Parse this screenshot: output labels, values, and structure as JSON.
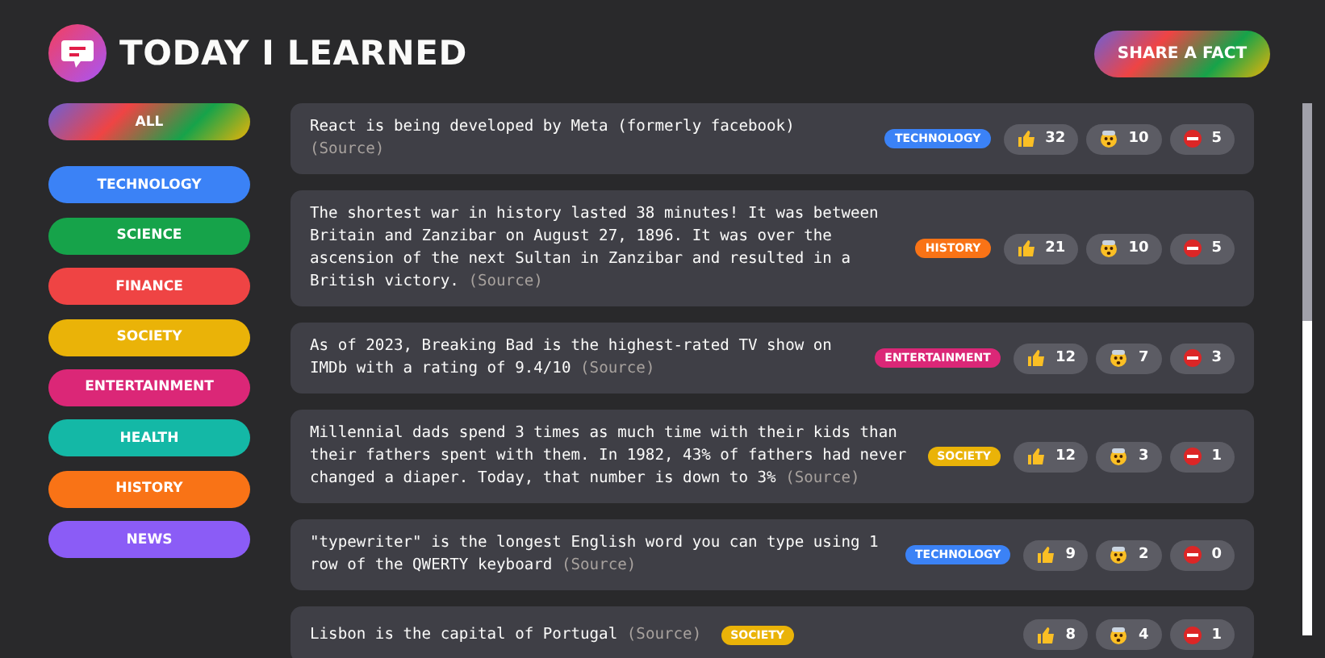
{
  "header": {
    "title": "TODAY I LEARNED",
    "share_button": "SHARE A FACT"
  },
  "categories": [
    {
      "label": "ALL",
      "kind": "all"
    },
    {
      "label": "TECHNOLOGY",
      "kind": "category",
      "color": "#3b82f6"
    },
    {
      "label": "SCIENCE",
      "kind": "category",
      "color": "#16a34a"
    },
    {
      "label": "FINANCE",
      "kind": "category",
      "color": "#ef4444"
    },
    {
      "label": "SOCIETY",
      "kind": "category",
      "color": "#eab308"
    },
    {
      "label": "ENTERTAINMENT",
      "kind": "category",
      "color": "#db2777"
    },
    {
      "label": "HEALTH",
      "kind": "category",
      "color": "#14b8a6"
    },
    {
      "label": "HISTORY",
      "kind": "category",
      "color": "#f97316"
    },
    {
      "label": "NEWS",
      "kind": "category",
      "color": "#8b5cf6"
    }
  ],
  "facts": [
    {
      "text": "React is being developed by Meta (formerly facebook)",
      "source": "(Source)",
      "tag": "TECHNOLOGY",
      "color": "#3b82f6",
      "votes": [
        "32",
        "10",
        "5"
      ]
    },
    {
      "text": "The shortest war in history lasted 38 minutes! It was between Britain and Zanzibar on August 27, 1896. It was over the ascension of the next Sultan in Zanzibar and resulted in a British victory.",
      "source": "(Source)",
      "tag": "HISTORY",
      "color": "#f97316",
      "votes": [
        "21",
        "10",
        "5"
      ]
    },
    {
      "text": "As of 2023, Breaking Bad is the highest-rated TV show on IMDb with a rating of 9.4/10",
      "source": "(Source)",
      "tag": "ENTERTAINMENT",
      "color": "#db2777",
      "votes": [
        "12",
        "7",
        "3"
      ]
    },
    {
      "text": "Millennial dads spend 3 times as much time with their kids than their fathers spent with them. In 1982, 43% of fathers had never changed a diaper. Today, that number is down to 3%",
      "source": "(Source)",
      "tag": "SOCIETY",
      "color": "#eab308",
      "votes": [
        "12",
        "3",
        "1"
      ]
    },
    {
      "text": "\"typewriter\" is the longest English word you can type using 1 row of the QWERTY keyboard",
      "source": "(Source)",
      "tag": "TECHNOLOGY",
      "color": "#3b82f6",
      "votes": [
        "9",
        "2",
        "0"
      ]
    },
    {
      "text": "Lisbon is the capital of Portugal",
      "source": "(Source)",
      "tag": "SOCIETY",
      "color": "#eab308",
      "votes": [
        "8",
        "4",
        "1"
      ]
    }
  ]
}
